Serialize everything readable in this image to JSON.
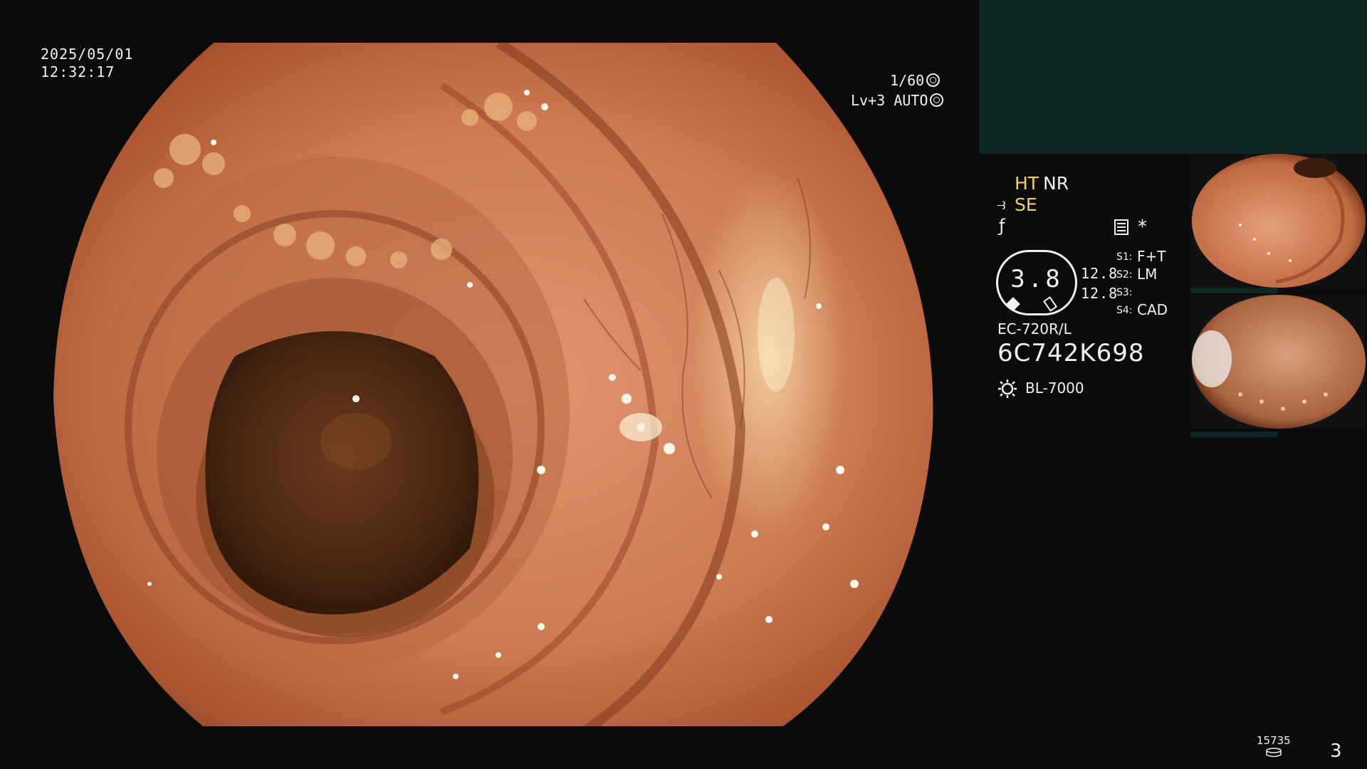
{
  "overlay": {
    "date": "2025/05/01",
    "time": "12:32:17",
    "shutter": "1/60",
    "level": "Lv+3 AUTO"
  },
  "modes": {
    "ht": "HT",
    "nr": "NR",
    "se": "SE"
  },
  "gauge": {
    "value": "3.8",
    "top": "12.8",
    "bottom": "12.8"
  },
  "settings": [
    {
      "label": "S1:",
      "value": "F+T"
    },
    {
      "label": "S2:",
      "value": "LM"
    },
    {
      "label": "S3:",
      "value": ""
    },
    {
      "label": "S4:",
      "value": "CAD"
    }
  ],
  "scope": {
    "model": "EC-720R/L",
    "serial": "6C742K698",
    "light_source": "BL-7000"
  },
  "footer": {
    "counter": "15735",
    "frame": "3"
  },
  "icons": [
    "shutter-icon",
    "auto-iris-icon",
    "structure-enhance-icon",
    "color-enhance-icon",
    "menu-icon",
    "star-icon",
    "light-source-icon",
    "disk-icon"
  ],
  "colors": {
    "background": "#0b0b0b",
    "top_panel": "#0e2622",
    "mode_accent": "#f4d15a",
    "tissue": "#c9704a"
  }
}
